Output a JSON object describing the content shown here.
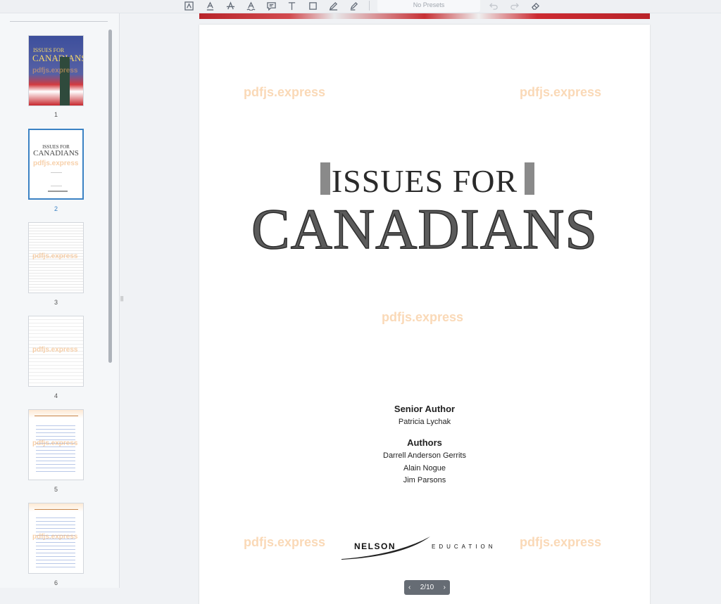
{
  "toolbar": {
    "tools": [
      "signature-icon",
      "underline-icon",
      "strikeout-icon",
      "squiggly-icon",
      "comment-icon",
      "text-icon",
      "rectangle-icon",
      "pen-icon",
      "highlighter-icon"
    ],
    "presets_label": "No Presets",
    "actions": [
      "undo-icon",
      "redo-icon",
      "eraser-icon"
    ]
  },
  "sidebar": {
    "thumbnails": [
      {
        "number": "1",
        "title_top": "ISSUES FOR",
        "title_bottom": "CANADIANS",
        "watermark": "pdfjs.express"
      },
      {
        "number": "2",
        "title_top": "ISSUES FOR",
        "title_bottom": "CANADIANS",
        "watermark": "pdfjs.express"
      },
      {
        "number": "3",
        "watermark": "pdfjs.express"
      },
      {
        "number": "4",
        "watermark": "pdfjs.express"
      },
      {
        "number": "5",
        "watermark": "pdfjs.express"
      },
      {
        "number": "6",
        "watermark": "pdfjs.express"
      }
    ]
  },
  "page": {
    "watermark": "pdfjs.express",
    "title_line1": "ISSUES FOR",
    "title_line2": "CANADIANS",
    "senior_author_label": "Senior Author",
    "senior_author": "Patricia Lychak",
    "authors_label": "Authors",
    "authors": [
      "Darrell Anderson Gerrits",
      "Alain Nogue",
      "Jim Parsons"
    ],
    "publisher": "NELSON",
    "publisher_sub": "EDUCATION"
  },
  "pagenav": {
    "current": "2",
    "separator": "/",
    "total": "10"
  },
  "colors": {
    "accent": "#3b82c4",
    "watermark": "#f5aa5f"
  }
}
